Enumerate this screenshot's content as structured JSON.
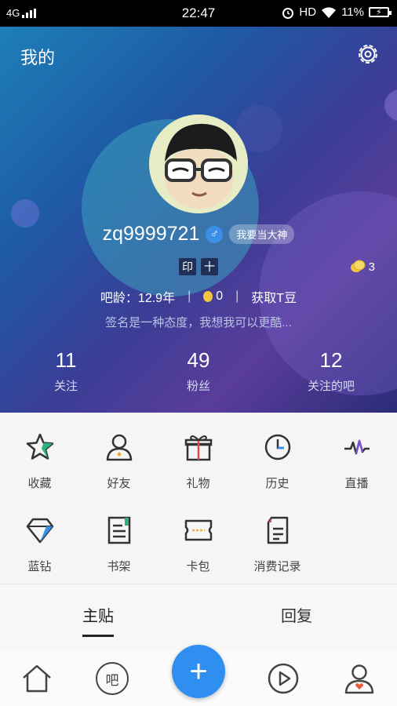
{
  "status_bar": {
    "network": "4G",
    "time": "22:47",
    "hd": "HD",
    "battery": "11%"
  },
  "header": {
    "title": "我的"
  },
  "profile": {
    "username": "zq9999721",
    "gender_symbol": "♂",
    "badge": "我要当大神",
    "stamps": [
      "印",
      "十"
    ],
    "coin_count": "3",
    "age_label": "吧龄：12.9年",
    "beans": "0",
    "get_beans": "获取T豆",
    "signature": "签名是一种态度，我想我可以更酷..."
  },
  "stats": [
    {
      "value": "11",
      "label": "关注"
    },
    {
      "value": "49",
      "label": "粉丝"
    },
    {
      "value": "12",
      "label": "关注的吧"
    }
  ],
  "grid_items": [
    {
      "label": "收藏",
      "icon": "star-icon"
    },
    {
      "label": "好友",
      "icon": "friend-icon"
    },
    {
      "label": "礼物",
      "icon": "gift-icon"
    },
    {
      "label": "历史",
      "icon": "clock-icon"
    },
    {
      "label": "直播",
      "icon": "live-icon"
    },
    {
      "label": "蓝钻",
      "icon": "diamond-icon"
    },
    {
      "label": "书架",
      "icon": "bookshelf-icon"
    },
    {
      "label": "卡包",
      "icon": "card-icon"
    },
    {
      "label": "消费记录",
      "icon": "record-icon"
    }
  ],
  "tabs": {
    "main": "主贴",
    "reply": "回复"
  },
  "bottom_nav": {
    "bar_label": "吧",
    "fab": "+"
  },
  "colors": {
    "accent": "#2f8ff0",
    "live": "#7b4fd6",
    "diamond": "#3a8fe8"
  }
}
